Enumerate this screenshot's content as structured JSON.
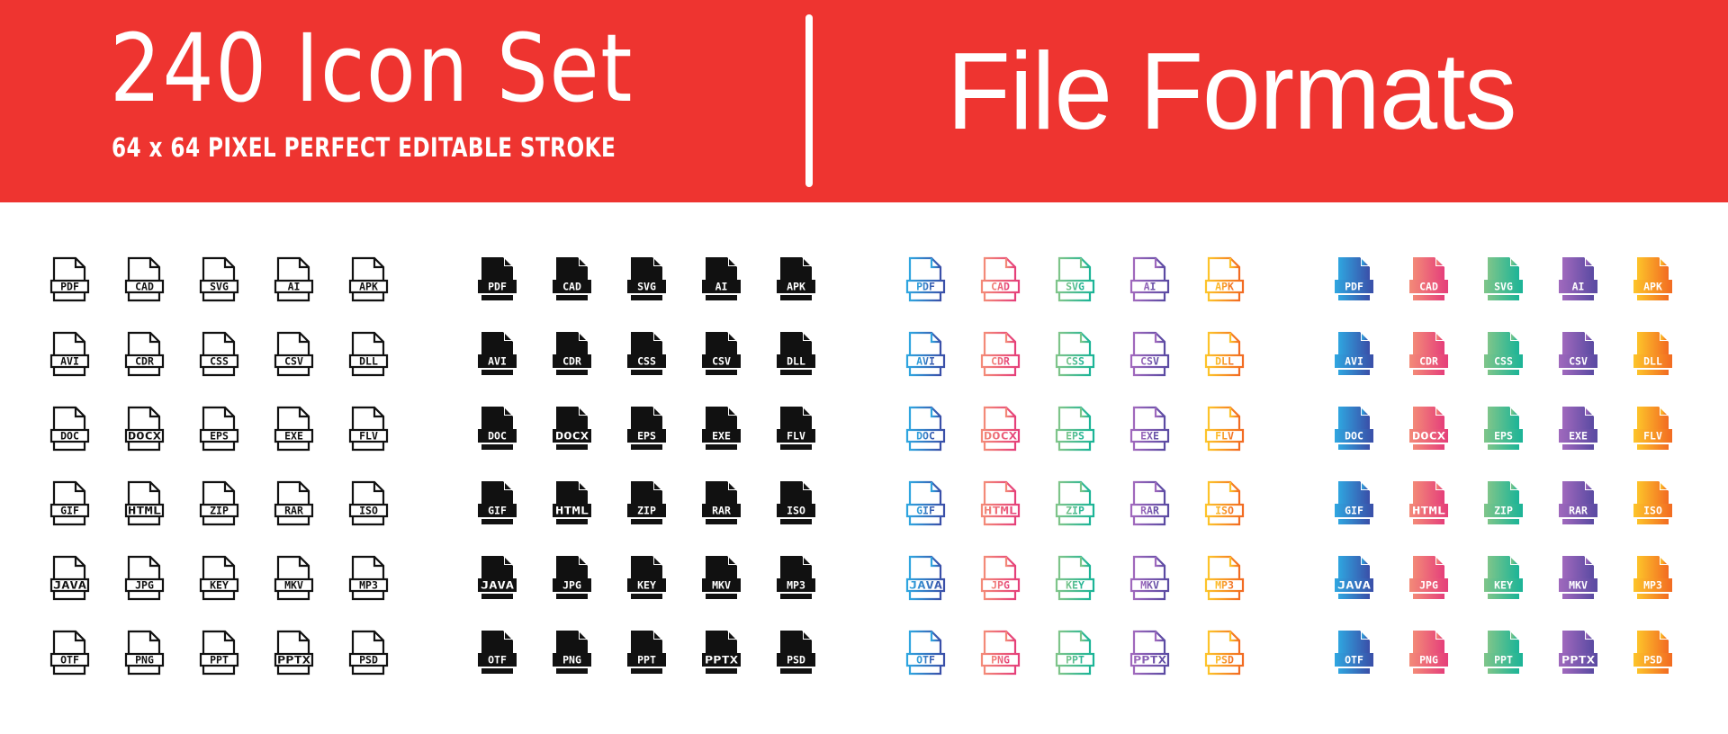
{
  "banner": {
    "title": "240 Icon Set",
    "subtitle": "64 x 64 PIXEL PERFECT EDITABLE STROKE",
    "heading": "File Formats",
    "background_color": "#ee3430",
    "text_color": "#ffffff"
  },
  "file_formats": [
    "PDF",
    "CAD",
    "SVG",
    "AI",
    "APK",
    "AVI",
    "CDR",
    "CSS",
    "CSV",
    "DLL",
    "DOC",
    "DOCX",
    "EPS",
    "EXE",
    "FLV",
    "GIF",
    "HTML",
    "ZIP",
    "RAR",
    "ISO",
    "JAVA",
    "JPG",
    "KEY",
    "MKV",
    "MP3",
    "OTF",
    "PNG",
    "PPT",
    "PPTX",
    "PSD"
  ],
  "icon_sets": [
    {
      "name": "outline",
      "style": "line-black"
    },
    {
      "name": "glyph",
      "style": "solid-black"
    },
    {
      "name": "gradient-outline",
      "style": "line-gradient"
    },
    {
      "name": "gradient-solid",
      "style": "solid-gradient"
    }
  ],
  "column_gradients": [
    {
      "from": "#2fa6e0",
      "to": "#3a4fa8"
    },
    {
      "from": "#f38a78",
      "to": "#e53f7a"
    },
    {
      "from": "#7fc58a",
      "to": "#1bb497"
    },
    {
      "from": "#a069bd",
      "to": "#5a4aa2"
    },
    {
      "from": "#fdc42a",
      "to": "#f26b22"
    }
  ],
  "ink_color": "#111111"
}
